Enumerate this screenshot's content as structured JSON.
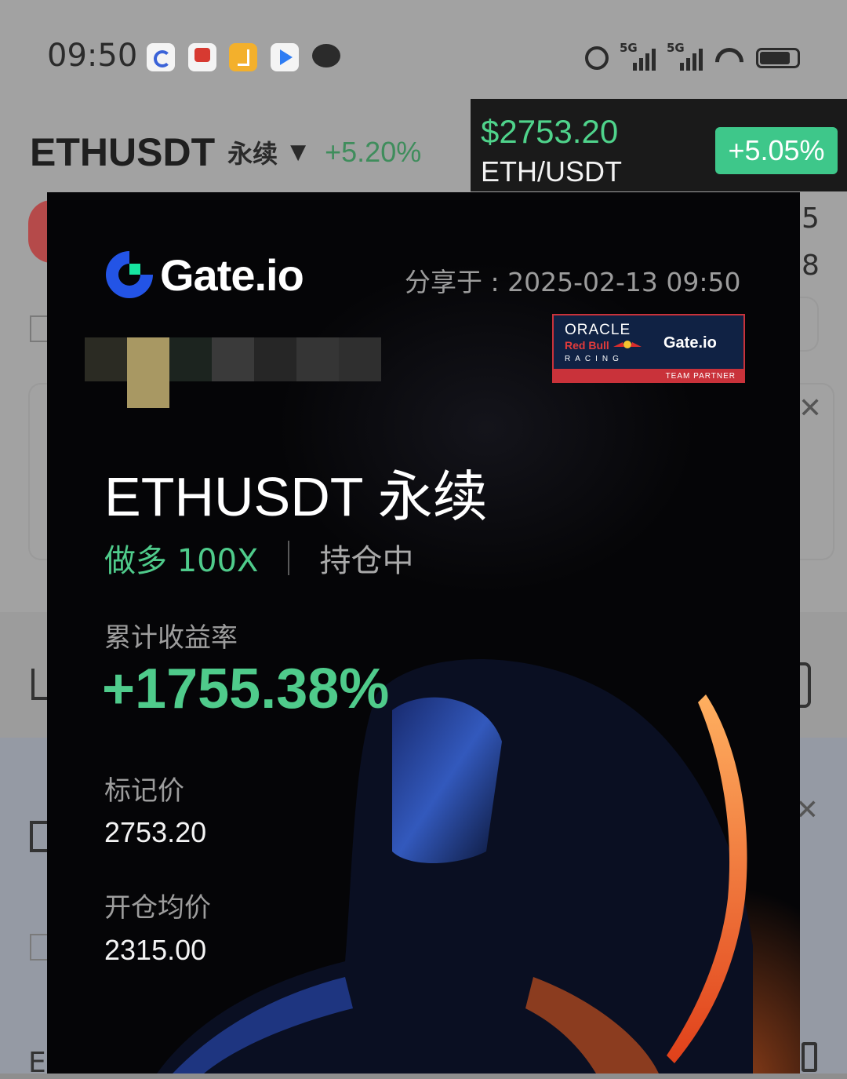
{
  "status_bar": {
    "time": "09:50",
    "notification_icons": [
      "gate-app-icon",
      "red-app-icon",
      "yellow-app-icon",
      "play-app-icon",
      "chat-bubble-icon"
    ],
    "signal_1_label": "5G",
    "signal_2_label": "5G"
  },
  "header": {
    "symbol": "ETHUSDT",
    "contract_type": "永续",
    "change": "+5.20%"
  },
  "ticker": {
    "price": "$2753.20",
    "pair": "ETH/USDT",
    "change_badge": "+5.05%"
  },
  "background": {
    "num1": "5",
    "num2": "8",
    "letter": "E"
  },
  "share_card": {
    "brand": "Gate.io",
    "share_time": "分享于 : 2025-02-13 09:50",
    "partner_badge": {
      "oracle": "ORACLE",
      "redbull": "Red Bull",
      "racing": "RACING",
      "gate": "Gate.io",
      "team_partner": "TEAM PARTNER"
    },
    "symbol_title": "ETHUSDT 永续",
    "side_leverage": "做多 100X",
    "position_status": "持仓中",
    "roi_label": "累计收益率",
    "roi_value": "+1755.38%",
    "mark_price_label": "标记价",
    "mark_price": "2753.20",
    "entry_price_label": "开仓均价",
    "entry_price": "2315.00"
  },
  "colors": {
    "profit_green": "#4fcb8b",
    "ticker_badge": "#3ec78a",
    "gate_blue": "#2354e6",
    "gate_green": "#17e5a0",
    "card_bg": "#050507"
  }
}
